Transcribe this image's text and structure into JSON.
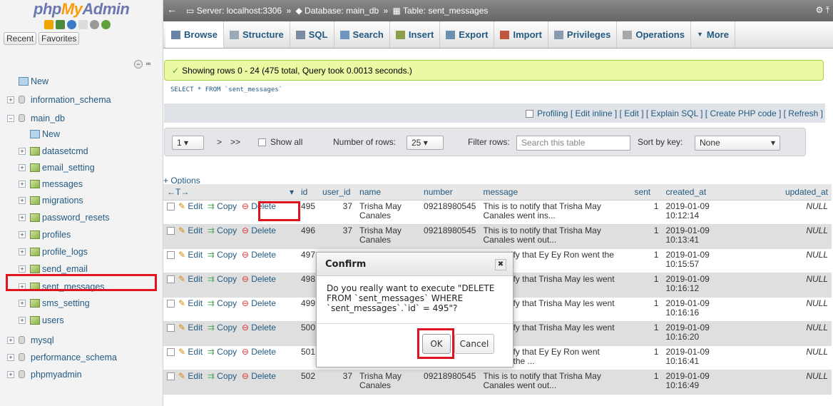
{
  "sidebar": {
    "logo_php": "php",
    "logo_my": "My",
    "logo_admin": "Admin",
    "recent_label": "Recent",
    "favorites_label": "Favorites",
    "tree": [
      {
        "label": "New",
        "level": 0,
        "kind": "new"
      },
      {
        "label": "information_schema",
        "level": 0,
        "kind": "db"
      },
      {
        "label": "main_db",
        "level": 0,
        "kind": "db"
      },
      {
        "label": "New",
        "level": 1,
        "kind": "new"
      },
      {
        "label": "datasetcmd",
        "level": 1,
        "kind": "table"
      },
      {
        "label": "email_setting",
        "level": 1,
        "kind": "table"
      },
      {
        "label": "messages",
        "level": 1,
        "kind": "table"
      },
      {
        "label": "migrations",
        "level": 1,
        "kind": "table"
      },
      {
        "label": "password_resets",
        "level": 1,
        "kind": "table"
      },
      {
        "label": "profiles",
        "level": 1,
        "kind": "table"
      },
      {
        "label": "profile_logs",
        "level": 1,
        "kind": "table"
      },
      {
        "label": "send_email",
        "level": 1,
        "kind": "table"
      },
      {
        "label": "sent_messages",
        "level": 1,
        "kind": "table"
      },
      {
        "label": "sms_setting",
        "level": 1,
        "kind": "table"
      },
      {
        "label": "users",
        "level": 1,
        "kind": "table"
      },
      {
        "label": "mysql",
        "level": 0,
        "kind": "db"
      },
      {
        "label": "performance_schema",
        "level": 0,
        "kind": "db"
      },
      {
        "label": "phpmyadmin",
        "level": 0,
        "kind": "db"
      }
    ]
  },
  "breadcrumb": {
    "server": "Server: localhost:3306",
    "database": "Database: main_db",
    "table": "Table: sent_messages",
    "sep": "»"
  },
  "tabs": [
    {
      "label": "Browse",
      "icon": "browse-icon"
    },
    {
      "label": "Structure",
      "icon": "structure-icon"
    },
    {
      "label": "SQL",
      "icon": "sql-icon"
    },
    {
      "label": "Search",
      "icon": "search-icon"
    },
    {
      "label": "Insert",
      "icon": "insert-icon"
    },
    {
      "label": "Export",
      "icon": "export-icon"
    },
    {
      "label": "Import",
      "icon": "import-icon"
    },
    {
      "label": "Privileges",
      "icon": "privileges-icon"
    },
    {
      "label": "Operations",
      "icon": "operations-icon"
    },
    {
      "label": "More",
      "icon": "more-icon"
    }
  ],
  "notice": "Showing rows 0 - 24 (475 total, Query took 0.0013 seconds.)",
  "sql_query": "SELECT * FROM `sent_messages`",
  "profiling": {
    "label": "Profiling",
    "links": "[ Edit inline ] [ Edit ] [ Explain SQL ] [ Create PHP code ] [ Refresh ]"
  },
  "nav": {
    "page": "1",
    "next": ">",
    "last": ">>",
    "show_all": "Show all",
    "rows_label": "Number of rows:",
    "rows_value": "25",
    "filter_label": "Filter rows:",
    "filter_placeholder": "Search this table",
    "sort_label": "Sort by key:",
    "sort_value": "None"
  },
  "options_label": "+ Options",
  "columns": [
    "id",
    "user_id",
    "name",
    "number",
    "message",
    "sent",
    "created_at",
    "updated_at"
  ],
  "row_actions": {
    "edit": "Edit",
    "copy": "Copy",
    "delete": "Delete"
  },
  "rows": [
    {
      "id": "495",
      "user_id": "37",
      "name": "Trisha May Canales",
      "number": "09218980545",
      "message": "This is to notify that Trisha May Canales went ins...",
      "sent": "1",
      "created_at": "2019-01-09 10:12:14",
      "updated_at": "NULL"
    },
    {
      "id": "496",
      "user_id": "37",
      "name": "Trisha May Canales",
      "number": "09218980545",
      "message": "This is to notify that Trisha May Canales went out...",
      "sent": "1",
      "created_at": "2019-01-09 10:13:41",
      "updated_at": "NULL"
    },
    {
      "id": "497",
      "user_id": "",
      "name": "",
      "number": "",
      "message": "s to notify that Ey Ey Ron went the s...",
      "sent": "1",
      "created_at": "2019-01-09 10:15:57",
      "updated_at": "NULL"
    },
    {
      "id": "498",
      "user_id": "",
      "name": "",
      "number": "",
      "message": "s to notify that Trisha May les went ins...",
      "sent": "1",
      "created_at": "2019-01-09 10:16:12",
      "updated_at": "NULL"
    },
    {
      "id": "499",
      "user_id": "",
      "name": "",
      "number": "",
      "message": "s to notify that Trisha May les went out...",
      "sent": "1",
      "created_at": "2019-01-09 10:16:16",
      "updated_at": "NULL"
    },
    {
      "id": "500",
      "user_id": "",
      "name": "",
      "number": "",
      "message": "s to notify that Trisha May les went ins...",
      "sent": "1",
      "created_at": "2019-01-09 10:16:20",
      "updated_at": "NULL"
    },
    {
      "id": "501",
      "user_id": "",
      "name": "",
      "number": "",
      "message": "s to notify that Ey Ey Ron went outside the ...",
      "sent": "1",
      "created_at": "2019-01-09 10:16:41",
      "updated_at": "NULL"
    },
    {
      "id": "502",
      "user_id": "37",
      "name": "Trisha May Canales",
      "number": "09218980545",
      "message": "This is to notify that Trisha May Canales went out...",
      "sent": "1",
      "created_at": "2019-01-09 10:16:49",
      "updated_at": "NULL"
    }
  ],
  "dialog": {
    "title": "Confirm",
    "message": "Do you really want to execute \"DELETE FROM `sent_messages` WHERE `sent_messages`.`id` = 495\"?",
    "ok": "OK",
    "cancel": "Cancel"
  },
  "colors": {
    "highlight": "#e0141e",
    "link": "#235a81",
    "notice_bg": "#ebf8a4"
  }
}
